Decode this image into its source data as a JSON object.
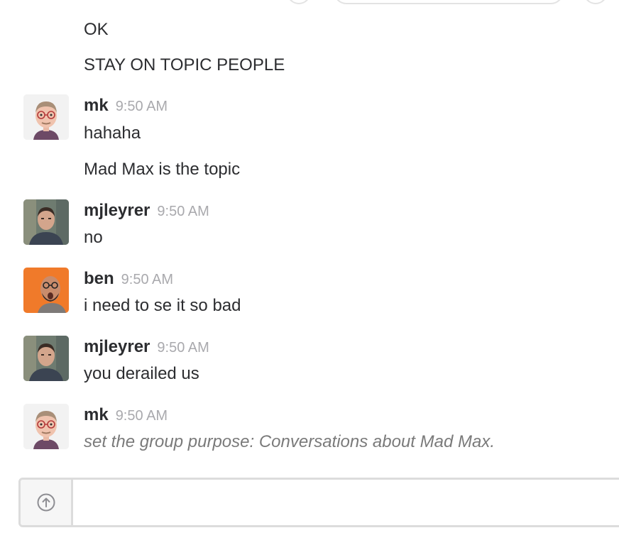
{
  "messages": [
    {
      "author": null,
      "time": null,
      "avatar": null,
      "lines": [
        "OK",
        "STAY ON TOPIC PEOPLE"
      ]
    },
    {
      "author": "mk",
      "time": "9:50 AM",
      "avatar": "cartoon-avatar-icon",
      "lines": [
        "hahaha",
        "Mad Max is the topic"
      ]
    },
    {
      "author": "mjleyrer",
      "time": "9:50 AM",
      "avatar": "photo-avatar-icon",
      "lines": [
        "no"
      ]
    },
    {
      "author": "ben",
      "time": "9:50 AM",
      "avatar": "orange-photo-avatar-icon",
      "lines": [
        "i need to se it so bad"
      ]
    },
    {
      "author": "mjleyrer",
      "time": "9:50 AM",
      "avatar": "photo-avatar-icon",
      "lines": [
        "you derailed us"
      ]
    },
    {
      "author": "mk",
      "time": "9:50 AM",
      "avatar": "cartoon-avatar-icon",
      "lines": [
        "set the group purpose: Conversations about Mad Max."
      ],
      "is_meta": true
    }
  ],
  "composer": {
    "upload_icon": "upload-arrow-icon",
    "value": "",
    "placeholder": ""
  },
  "colors": {
    "text": "#2c2d30",
    "timestamp": "#a9a9ad",
    "meta_text": "#7a7a7a",
    "border": "#dcdcdc",
    "ben_avatar_bg": "#f07a2a"
  }
}
